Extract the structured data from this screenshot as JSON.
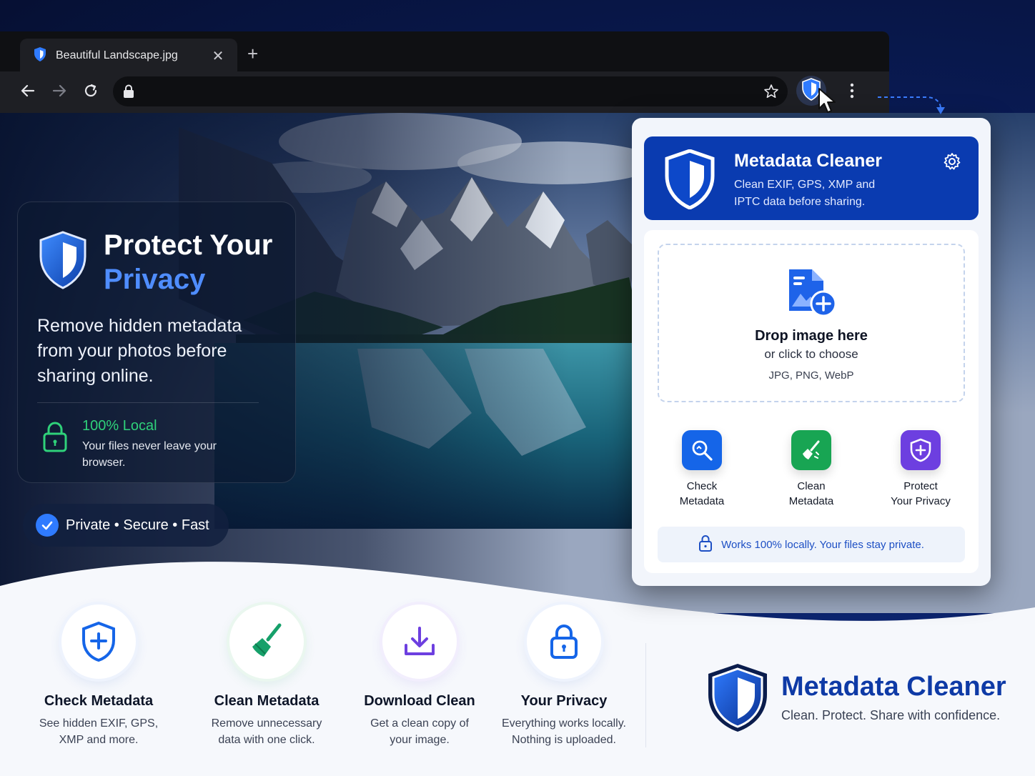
{
  "browser": {
    "tab_title": "Beautiful Landscape.jpg",
    "tab_close": "✕",
    "new_tab": "+"
  },
  "hero": {
    "title_line1": "Protect Your",
    "title_line2": "Privacy",
    "description": "Remove hidden metadata from your photos before sharing online.",
    "local_title": "100% Local",
    "local_desc": "Your files never leave your browser.",
    "pill_text": "Private • Secure • Fast"
  },
  "popup": {
    "title": "Metadata Cleaner",
    "subtitle": "Clean EXIF, GPS, XMP and IPTC data before sharing.",
    "drop_title": "Drop image here",
    "drop_sub": "or click to choose",
    "drop_types": "JPG, PNG, WebP",
    "actions": [
      {
        "line1": "Check",
        "line2": "Metadata",
        "icon": "magnifier-icon",
        "color": "#1565e8"
      },
      {
        "line1": "Clean",
        "line2": "Metadata",
        "icon": "broom-icon",
        "color": "#18a553"
      },
      {
        "line1": "Protect",
        "line2": "Your Privacy",
        "icon": "shield-plus-icon",
        "color": "#6d3fe0"
      }
    ],
    "local_note": "Works 100% locally. Your files stay private."
  },
  "features": [
    {
      "title": "Check Metadata",
      "desc_line1": "See hidden EXIF, GPS,",
      "desc_line2": "XMP and more.",
      "icon": "shield-plus-icon"
    },
    {
      "title": "Clean Metadata",
      "desc_line1": "Remove unnecessary",
      "desc_line2": "data with one click.",
      "icon": "broom-icon"
    },
    {
      "title": "Download Clean",
      "desc_line1": "Get a clean copy of",
      "desc_line2": "your image.",
      "icon": "download-icon"
    },
    {
      "title": "Your Privacy",
      "desc_line1": "Everything works locally.",
      "desc_line2": "Nothing is uploaded.",
      "icon": "lock-icon"
    }
  ],
  "brand": {
    "title": "Metadata Cleaner",
    "tagline": "Clean. Protect. Share with confidence."
  },
  "colors": {
    "accent_blue": "#0a3bb0",
    "privacy_blue": "#4f8dff",
    "local_green": "#2fd17a"
  }
}
